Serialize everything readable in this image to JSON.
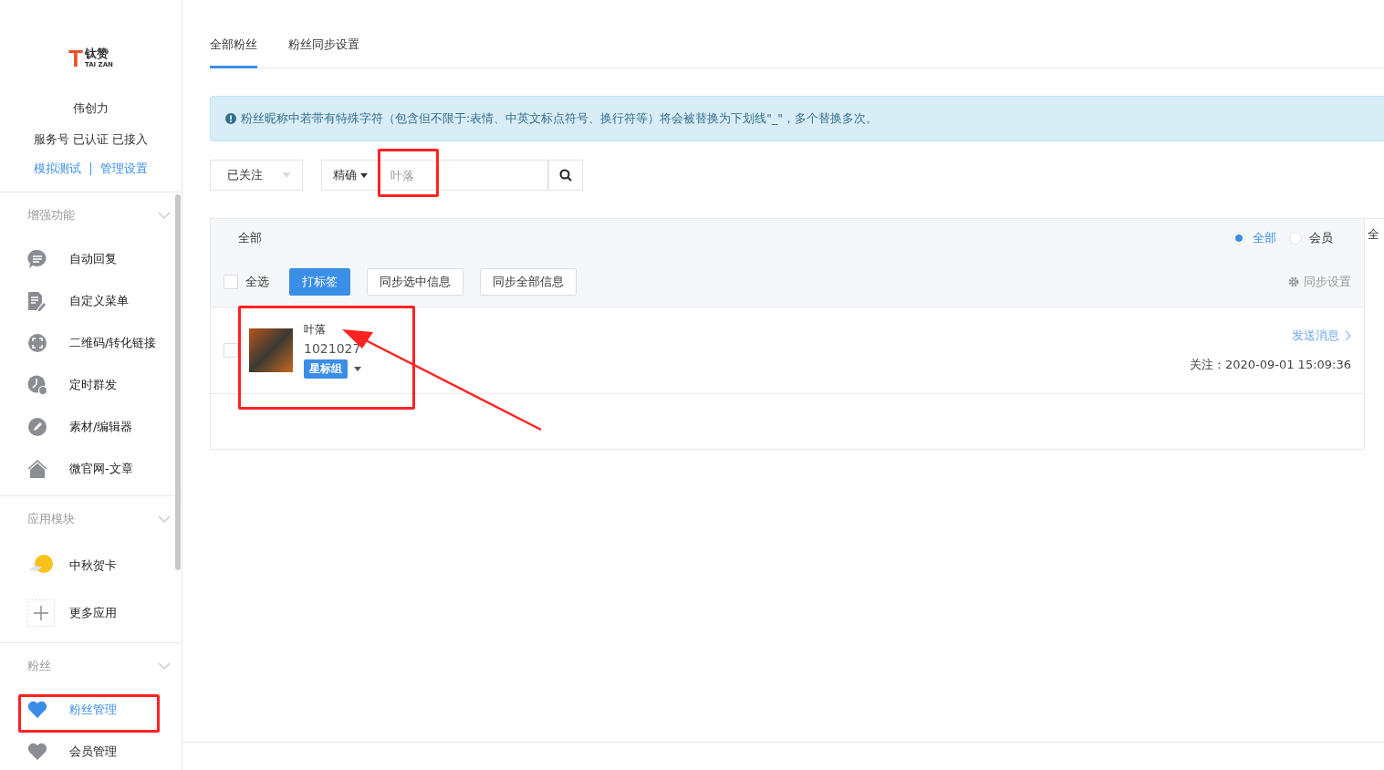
{
  "logo": {
    "mark": "T",
    "name": "钛赞",
    "sub": "TAI ZAN"
  },
  "account": {
    "name": "伟创力",
    "status": "服务号 已认证 已接入",
    "links": [
      "模拟测试",
      "管理设置"
    ]
  },
  "nav_groups": [
    {
      "title": "增强功能",
      "items": [
        {
          "label": "自动回复",
          "kind": "chat",
          "selected": false,
          "annotated": false
        },
        {
          "label": "自定义菜单",
          "kind": "doc",
          "selected": false,
          "annotated": false
        },
        {
          "label": "二维码/转化链接",
          "kind": "qr",
          "selected": false,
          "annotated": false
        },
        {
          "label": "定时群发",
          "kind": "clock",
          "selected": false,
          "annotated": false
        },
        {
          "label": "素材/编辑器",
          "kind": "pen",
          "selected": false,
          "annotated": false
        },
        {
          "label": "微官网-文章",
          "kind": "home",
          "selected": false,
          "annotated": false
        }
      ]
    },
    {
      "title": "应用模块",
      "items": [
        {
          "label": "中秋贺卡",
          "kind": "moon",
          "selected": false,
          "annotated": false
        },
        {
          "label": "更多应用",
          "kind": "plus",
          "selected": false,
          "annotated": false
        }
      ]
    },
    {
      "title": "粉丝",
      "items": [
        {
          "label": "粉丝管理",
          "kind": "heart",
          "selected": true,
          "annotated": true
        },
        {
          "label": "会员管理",
          "kind": "heart",
          "selected": false,
          "annotated": false
        }
      ]
    }
  ],
  "tabs": [
    {
      "label": "全部粉丝",
      "selected": true
    },
    {
      "label": "粉丝同步设置",
      "selected": false
    }
  ],
  "notice": "粉丝昵称中若带有特殊字符（包含但不限于:表情、中英文标点符号、换行符等）将会被替换为下划线\"_\"，多个替换多次。",
  "filters": {
    "status": "已关注",
    "mode": "精确",
    "search": {
      "placeholder": "叶落",
      "annotated": true
    }
  },
  "panel": {
    "filter_label": "全部",
    "radios": [
      {
        "label": "全部",
        "selected": true
      },
      {
        "label": "会员",
        "selected": false
      }
    ],
    "select_all": {
      "label": "全选",
      "checked": false
    },
    "buttons": [
      {
        "label": "打标签",
        "kind": "primary"
      },
      {
        "label": "同步选中信息",
        "kind": "default"
      },
      {
        "label": "同步全部信息",
        "kind": "default"
      }
    ],
    "sync_settings": "同步设置",
    "fans": [
      {
        "name": "叶落",
        "id": "1021027",
        "tag": "星标组",
        "checked": false,
        "annotated": true,
        "action": "发送消息",
        "follow_time": "关注：2020-09-01 15:09:36"
      }
    ]
  },
  "side_panel": {
    "text": "全"
  }
}
